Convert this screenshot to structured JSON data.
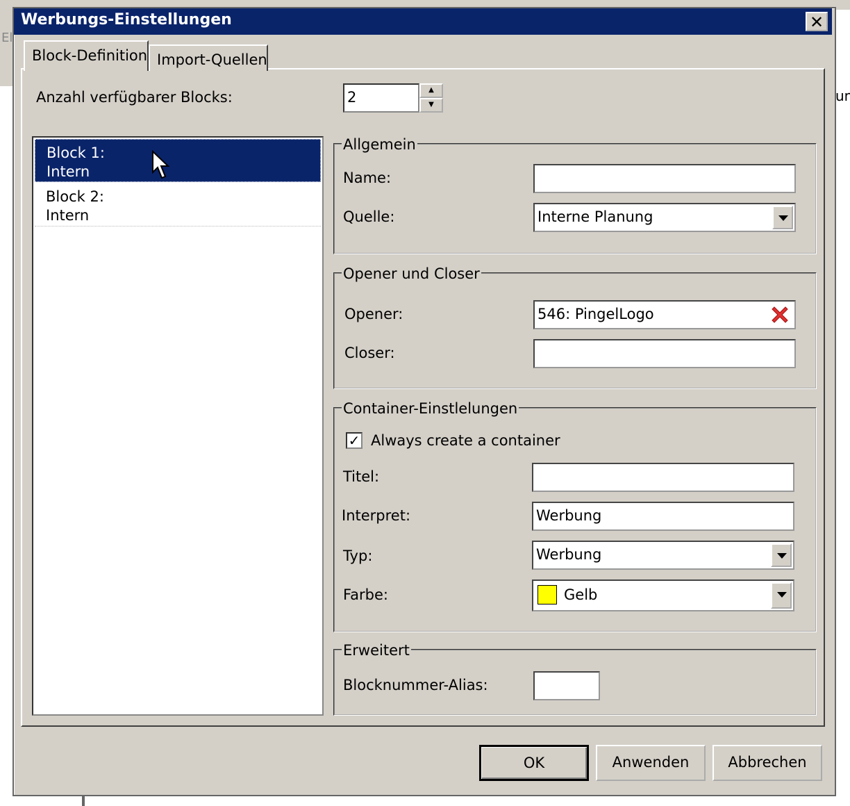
{
  "window": {
    "title": "Werbungs-Einstellungen",
    "close_label": "✕"
  },
  "background": {
    "left_text": "El",
    "right_text": "un"
  },
  "tabs": [
    {
      "label": "Block-Definition",
      "active": true
    },
    {
      "label": "Import-Quellen",
      "active": false
    }
  ],
  "blocks_count": {
    "label": "Anzahl verfügbarer Blocks:",
    "value": "2"
  },
  "block_list": [
    {
      "line1": "Block 1:",
      "line2": "Intern",
      "selected": true
    },
    {
      "line1": "Block 2:",
      "line2": "Intern",
      "selected": false
    }
  ],
  "allgemein": {
    "legend": "Allgemein",
    "name_label": "Name:",
    "name_value": "",
    "quelle_label": "Quelle:",
    "quelle_value": "Interne Planung"
  },
  "opener_closer": {
    "legend": "Opener und Closer",
    "opener_label": "Opener:",
    "opener_value": "546: PingelLogo",
    "closer_label": "Closer:",
    "closer_value": ""
  },
  "container": {
    "legend": "Container-Einstlelungen",
    "always_create_label": "Always create a container",
    "always_create_checked": true,
    "titel_label": "Titel:",
    "titel_value": "",
    "interpret_label": "Interpret:",
    "interpret_value": "Werbung",
    "typ_label": "Typ:",
    "typ_value": "Werbung",
    "farbe_label": "Farbe:",
    "farbe_value": "Gelb",
    "farbe_color": "#ffff00"
  },
  "erweitert": {
    "legend": "Erweitert",
    "alias_label": "Blocknummer-Alias:",
    "alias_value": ""
  },
  "buttons": {
    "ok": "OK",
    "apply": "Anwenden",
    "cancel": "Abbrechen"
  },
  "colors": {
    "titlebar": "#0a246a",
    "dialog_face": "#d4d0c8",
    "selection": "#0a246a",
    "remove_icon": "#e03030"
  }
}
